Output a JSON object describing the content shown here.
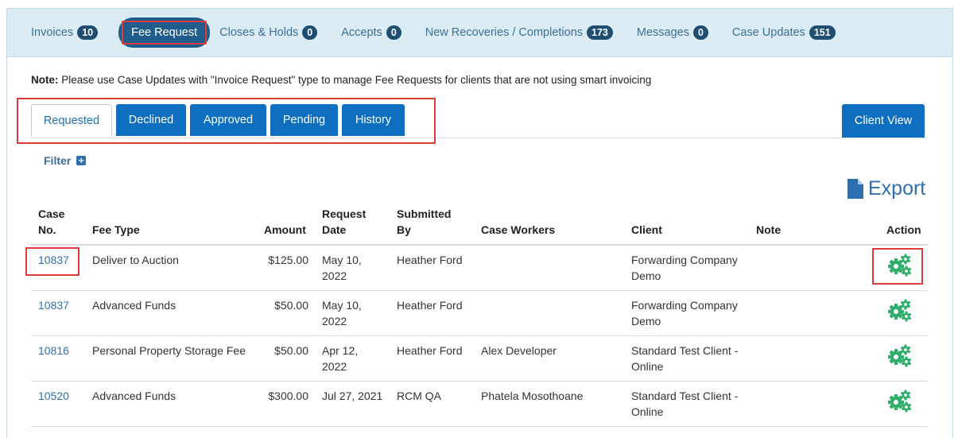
{
  "topnav": [
    {
      "label": "Invoices",
      "count": "10",
      "active": false
    },
    {
      "label": "Fee Request",
      "count": "",
      "active": true
    },
    {
      "label": "Closes & Holds",
      "count": "0",
      "active": false
    },
    {
      "label": "Accepts",
      "count": "0",
      "active": false
    },
    {
      "label": "New Recoveries / Completions",
      "count": "173",
      "active": false
    },
    {
      "label": "Messages",
      "count": "0",
      "active": false
    },
    {
      "label": "Case Updates",
      "count": "151",
      "active": false
    }
  ],
  "note": {
    "label": "Note:",
    "text": " Please use Case Updates with \"Invoice Request\" type to manage Fee Requests for clients that are not using smart invoicing"
  },
  "tabs": [
    {
      "label": "Requested"
    },
    {
      "label": "Declined"
    },
    {
      "label": "Approved"
    },
    {
      "label": "Pending"
    },
    {
      "label": "History"
    }
  ],
  "client_view_label": "Client View",
  "filter_label": "Filter",
  "export_label": "Export",
  "colors": {
    "accent": "#0e6fc0",
    "link": "#2e6fae",
    "gear": "#2fae6a",
    "highlight": "#e23b3b"
  },
  "table": {
    "headers": {
      "case_no": [
        "Case",
        "No."
      ],
      "fee_type": "Fee Type",
      "amount": "Amount",
      "request_date": [
        "Request",
        "Date"
      ],
      "submitted_by": [
        "Submitted",
        "By"
      ],
      "case_workers": "Case Workers",
      "client": "Client",
      "note": "Note",
      "action": "Action"
    },
    "rows": [
      {
        "case_no": "10837",
        "fee_type": "Deliver to Auction",
        "amount": "$125.00",
        "date1": "May 10,",
        "date2": "2022",
        "submitted_by": "Heather Ford",
        "case_workers": "",
        "client1": "Forwarding Company",
        "client2": "Demo",
        "note": ""
      },
      {
        "case_no": "10837",
        "fee_type": "Advanced Funds",
        "amount": "$50.00",
        "date1": "May 10,",
        "date2": "2022",
        "submitted_by": "Heather Ford",
        "case_workers": "",
        "client1": "Forwarding Company",
        "client2": "Demo",
        "note": ""
      },
      {
        "case_no": "10816",
        "fee_type": "Personal Property Storage Fee",
        "amount": "$50.00",
        "date1": "Apr 12,",
        "date2": "2022",
        "submitted_by": "Heather Ford",
        "case_workers": "Alex Developer",
        "client1": "Standard Test Client -",
        "client2": "Online",
        "note": ""
      },
      {
        "case_no": "10520",
        "fee_type": "Advanced Funds",
        "amount": "$300.00",
        "date1": "Jul 27, 2021",
        "date2": "",
        "submitted_by": "RCM QA",
        "case_workers": "Phatela Mosothoane",
        "client1": "Standard Test Client -",
        "client2": "Online",
        "note": ""
      }
    ]
  }
}
